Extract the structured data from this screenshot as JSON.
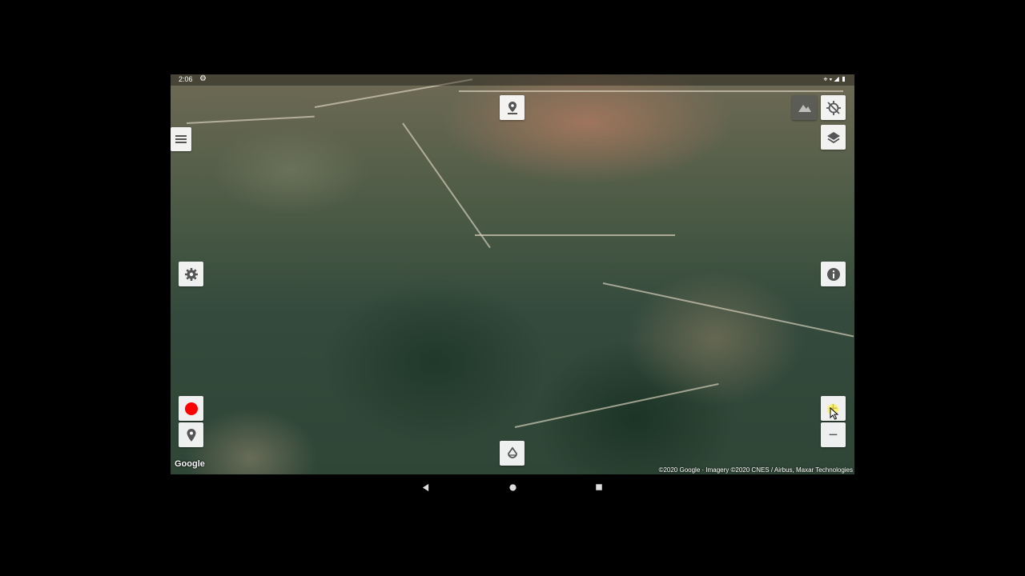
{
  "status_bar": {
    "time": "2:06",
    "settings_icon": "gear-icon",
    "right_icons": [
      "location-icon",
      "wifi-icon",
      "signal-icon",
      "battery-icon"
    ]
  },
  "map": {
    "type": "satellite",
    "google_logo": "Google",
    "attribution": "©2020 Google · Imagery ©2020 CNES / Airbus, Maxar Technologies"
  },
  "controls": {
    "menu": "menu-icon",
    "waypoint": "waypoint-icon",
    "gps_off": "gps-off-icon",
    "layers": "layers-icon",
    "settings": "gear-icon",
    "info": "info-icon",
    "record": "record-icon",
    "marker": "marker-icon",
    "center": "center-icon",
    "zoom_in": "+",
    "zoom_out": "−"
  },
  "colors": {
    "record": "#ff0000",
    "zoom_highlight": "#ffee3c"
  },
  "nav_bar": [
    "back-icon",
    "home-icon",
    "recents-icon"
  ]
}
